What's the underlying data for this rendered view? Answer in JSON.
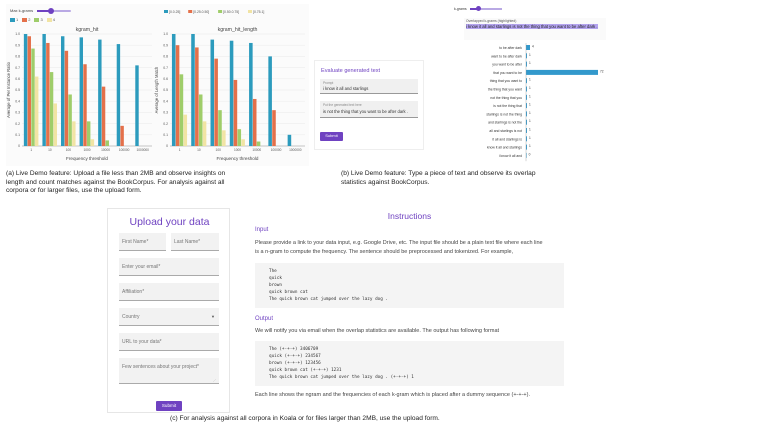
{
  "panel_a": {
    "slider_label": "Max k-grams",
    "legend": [
      {
        "label": "1",
        "color": "#2c9bbd"
      },
      {
        "label": "2",
        "color": "#e4704a"
      },
      {
        "label": "3",
        "color": "#9fcd6a"
      },
      {
        "label": "4",
        "color": "#f1e4a4"
      }
    ],
    "caption_lines": [
      "(a) Live Demo feature: Upload a file less than 2MB and observe insights on",
      "length and count matches against the BookCorpus. For analysis against all",
      "corpora or for larger files, use the upload form."
    ]
  },
  "chart_data": [
    {
      "type": "bar",
      "title": "kgram_hit",
      "xlabel": "Frequency threshold",
      "ylabel": "Average of Per Instance Ratio",
      "ylim": [
        0,
        1.0
      ],
      "yticks": [
        "0",
        "0.1",
        "0.2",
        "0.3",
        "0.4",
        "0.5",
        "0.6",
        "0.7",
        "0.8",
        "0.9",
        "1.0"
      ],
      "categories": [
        "1",
        "10",
        "100",
        "1000",
        "10000",
        "100000",
        "1000000"
      ],
      "series": [
        {
          "name": "1",
          "color": "#2c9bbd",
          "values": [
            1.0,
            1.0,
            0.98,
            0.97,
            0.95,
            0.91,
            0.72
          ]
        },
        {
          "name": "2",
          "color": "#e4704a",
          "values": [
            0.98,
            0.92,
            0.85,
            0.73,
            0.53,
            0.18,
            0.0
          ]
        },
        {
          "name": "3",
          "color": "#9fcd6a",
          "values": [
            0.87,
            0.66,
            0.46,
            0.22,
            0.05,
            0.0,
            0.0
          ]
        },
        {
          "name": "4",
          "color": "#f1e4a4",
          "values": [
            0.62,
            0.38,
            0.22,
            0.06,
            0.0,
            0.0,
            0.0
          ]
        }
      ]
    },
    {
      "type": "bar",
      "title": "kgram_hit_length",
      "xlabel": "Frequency threshold",
      "ylabel": "Average of Length Match",
      "ylim": [
        0,
        1.0
      ],
      "yticks": [
        "0",
        "0.1",
        "0.2",
        "0.3",
        "0.4",
        "0.5",
        "0.6",
        "0.7",
        "0.8",
        "0.9",
        "1.0"
      ],
      "categories": [
        "1",
        "10",
        "100",
        "1000",
        "10000",
        "100000",
        "1000000"
      ],
      "series": [
        {
          "name": "[0.0.25]",
          "color": "#2c9bbd",
          "values": [
            1.0,
            1.0,
            0.95,
            0.94,
            0.92,
            0.8,
            0.1
          ]
        },
        {
          "name": "[0.25.0.50]",
          "color": "#e4704a",
          "values": [
            0.9,
            0.88,
            0.78,
            0.59,
            0.42,
            0.32,
            0.0
          ]
        },
        {
          "name": "[0.50.0.75]",
          "color": "#9fcd6a",
          "values": [
            0.64,
            0.46,
            0.32,
            0.15,
            0.04,
            0.0,
            0.0
          ]
        },
        {
          "name": "[0.75.1]",
          "color": "#f1e4a4",
          "values": [
            0.28,
            0.22,
            0.14,
            0.06,
            0.0,
            0.0,
            0.0
          ]
        }
      ]
    },
    {
      "type": "bar",
      "orientation": "horizontal",
      "categories": [
        "to be after dark",
        "want to be after dark",
        "you want to be after",
        "that you want to be",
        "thing that you want to",
        "the thing that you want",
        "not the thing that you",
        "is not the thing that",
        "starlings is not the thing",
        "and starlings is not the",
        "all and starlings is not",
        "it all and starlings is",
        "know it all and starlings",
        "i know it all and"
      ],
      "values": [
        4,
        1,
        1,
        72,
        1,
        1,
        1,
        1,
        1,
        1,
        1,
        1,
        1,
        0
      ],
      "value_labels": [
        "4",
        "1",
        "1",
        "72",
        "1",
        "1",
        "1",
        "1",
        "1",
        "1",
        "1",
        "1",
        "1",
        "0"
      ]
    }
  ],
  "panel_b": {
    "card_title": "Evaluate generated text",
    "prompt_label": "Prompt",
    "prompt_value": "i know it all and starlings",
    "gen_label": "Put the generated text here",
    "gen_value": "is not the thing that you want to be after dark .",
    "submit_label": "Submit",
    "kgram_label": "k-grams",
    "overlap_title": "Overlapped k-grams (highlighted)",
    "overlap_text": "i know it all and starlings is not the thing that you want to be after dark .",
    "caption_lines": [
      "(b) Live Demo feature: Type a piece of text and observe its overlap",
      "statistics against BookCorpus."
    ]
  },
  "panel_c": {
    "upload_title": "Upload your data",
    "first_name": "First Name*",
    "last_name": "Last Name*",
    "email": "Enter your email*",
    "affiliation": "Affiliation*",
    "country": "Country",
    "url": "URL to your data*",
    "project": "Few sentences about your project*",
    "submit_label": "Submit",
    "instructions_title": "Instructions",
    "input_heading": "Input",
    "input_text_1": "Please provide a link to your data input, e.g. Google Drive, etc. The input file should be a plain text file where each line",
    "input_text_2": "is a n-gram to compute the frequency. The sentence should be preprocessed and tokenized. For example,",
    "input_code": [
      "The",
      "quick",
      "brown",
      "quick brown cat",
      "The quick brown cat jumped over the lazy dog ."
    ],
    "output_heading": "Output",
    "output_text": "We will notify you via email when the overlap statistics are available. The output has following format",
    "output_code": [
      "The (+-+-+) 3406709",
      "quick (+-+-+) 234567",
      "brown (+-+-+) 123456",
      "quick brown cat (+-+-+) 1231",
      "The quick brown cat jumped over the lazy dog . (+-+-+) 1"
    ],
    "footer_text": "Each line shows the ngram and the frequencies of each k-gram which is placed after a dummy sequence (+-+-+).",
    "caption": "(c) For analysis against all corpora in Koala or for files larger than 2MB, use the upload form."
  }
}
